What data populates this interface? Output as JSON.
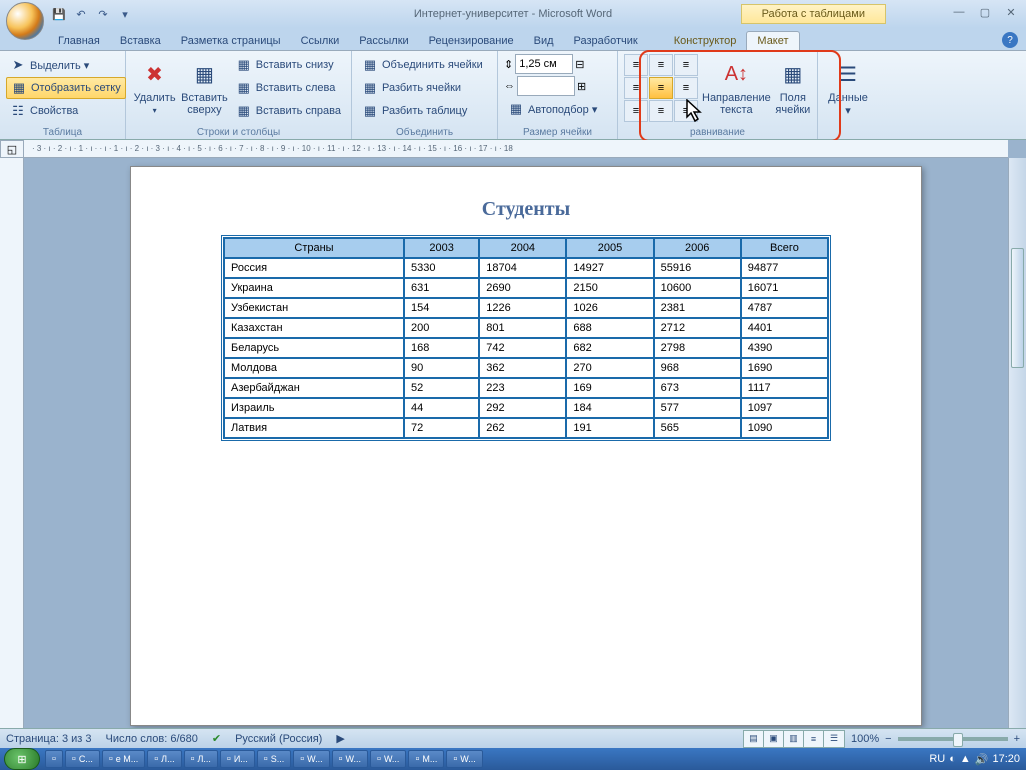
{
  "title": "Интернет-университет - Microsoft Word",
  "contextualLabel": "Работа с таблицами",
  "tabs": [
    "Главная",
    "Вставка",
    "Разметка страницы",
    "Ссылки",
    "Рассылки",
    "Рецензирование",
    "Вид",
    "Разработчик"
  ],
  "contextualTabs": [
    "Конструктор",
    "Макет"
  ],
  "groups": {
    "table": {
      "label": "Таблица",
      "select": "Выделить ▾",
      "grid": "Отобразить сетку",
      "props": "Свойства"
    },
    "rowsCols": {
      "label": "Строки и столбцы",
      "delete": "Удалить",
      "insertAbove": "Вставить сверху",
      "insertBelow": "Вставить снизу",
      "insertLeft": "Вставить слева",
      "insertRight": "Вставить справа"
    },
    "merge": {
      "label": "Объединить",
      "mergeCells": "Объединить ячейки",
      "splitCells": "Разбить ячейки",
      "splitTable": "Разбить таблицу"
    },
    "cellSize": {
      "label": "Размер ячейки",
      "height": "1,25 см",
      "width": "",
      "autofit": "Автоподбор ▾"
    },
    "alignment": {
      "label": "равнивание",
      "textDir": "Направление текста",
      "margins": "Поля ячейки"
    },
    "data": {
      "label": "",
      "btn": "Данные ▾"
    }
  },
  "doc": {
    "heading": "Студенты",
    "headers": [
      "Страны",
      "2003",
      "2004",
      "2005",
      "Всего"
    ],
    "headers2006": "2006",
    "rows": [
      [
        "Россия",
        "5330",
        "18704",
        "14927",
        "55916",
        "94877"
      ],
      [
        "Украина",
        "631",
        "2690",
        "2150",
        "10600",
        "16071"
      ],
      [
        "Узбекистан",
        "154",
        "1226",
        "1026",
        "2381",
        "4787"
      ],
      [
        "Казахстан",
        "200",
        "801",
        "688",
        "2712",
        "4401"
      ],
      [
        "Беларусь",
        "168",
        "742",
        "682",
        "2798",
        "4390"
      ],
      [
        "Молдова",
        "90",
        "362",
        "270",
        "968",
        "1690"
      ],
      [
        "Азербайджан",
        "52",
        "223",
        "169",
        "673",
        "1117"
      ],
      [
        "Израиль",
        "44",
        "292",
        "184",
        "577",
        "1097"
      ],
      [
        "Латвия",
        "72",
        "262",
        "191",
        "565",
        "1090"
      ]
    ]
  },
  "status": {
    "page": "Страница: 3 из 3",
    "words": "Число слов: 6/680",
    "lang": "Русский (Россия)",
    "zoom": "100%"
  },
  "rulerText": "· 3 · ı · 2 · ı · 1 · ı ·   · ı · 1 · ı · 2 · ı · 3 · ı · 4 · ı · 5 · ı · 6 · ı · 7 · ı · 8 · ı · 9 · ı · 10 · ı · 11 · ı · 12 · ı · 13 · ı · 14 · ı · 15 · ı · 16 · ı · 17 · ı · 18",
  "taskbar": {
    "items": [
      " ",
      "C...",
      "e M...",
      "Л...",
      "Л...",
      "И...",
      "S...",
      "W...",
      "W...",
      "W...",
      "M...",
      "W..."
    ],
    "lang": "RU",
    "time": "17:20"
  }
}
